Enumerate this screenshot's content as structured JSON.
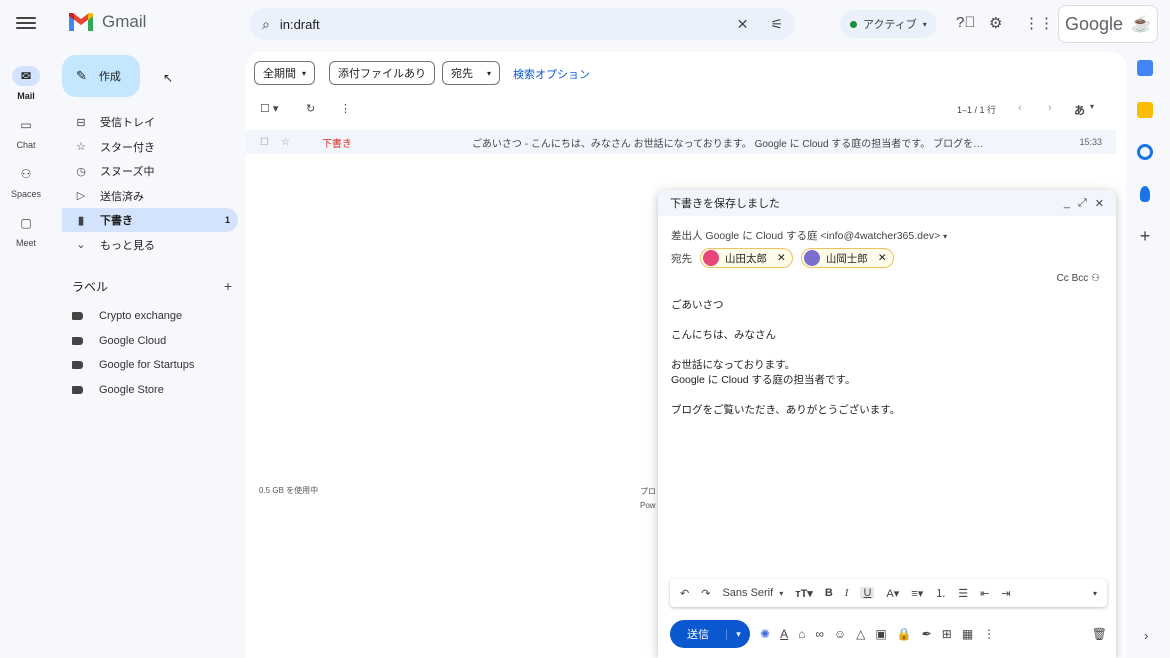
{
  "rail": {
    "items": [
      {
        "label": "Mail"
      },
      {
        "label": "Chat"
      },
      {
        "label": "Spaces"
      },
      {
        "label": "Meet"
      }
    ]
  },
  "app": {
    "name": "Gmail"
  },
  "search": {
    "query": "in:draft"
  },
  "status": {
    "label": "アクティブ"
  },
  "brand": {
    "google_text": "Google"
  },
  "compose": {
    "label": "作成"
  },
  "nav": {
    "items": [
      {
        "label": "受信トレイ",
        "count": ""
      },
      {
        "label": "スター付き",
        "count": ""
      },
      {
        "label": "スヌーズ中",
        "count": ""
      },
      {
        "label": "送信済み",
        "count": ""
      },
      {
        "label": "下書き",
        "count": "1"
      },
      {
        "label": "もっと見る",
        "count": ""
      }
    ]
  },
  "labels": {
    "heading": "ラベル",
    "items": [
      "Crypto exchange",
      "Google Cloud",
      "Google for Startups",
      "Google Store"
    ]
  },
  "filters": {
    "period": "全期間",
    "attachment": "添付ファイルあり",
    "to": "宛先",
    "search_options": "検索オプション"
  },
  "list": {
    "pagination": "1–1 / 1 行",
    "input_tool": "あ",
    "rows": [
      {
        "label": "下書き",
        "snippet": "ごあいさつ - こんにちは、みなさん お世話になっております。 Google に Cloud する庭の担当者です。 ブログを…",
        "time": "15:33"
      }
    ]
  },
  "footer": {
    "storage": "0.5 GB を使用中",
    "line1": "プロ",
    "line2": "Pow"
  },
  "draft": {
    "title": "下書きを保存しました",
    "from": "差出人 Google に Cloud する庭 <info@4watcher365.dev>",
    "to_label": "宛先",
    "recipients": [
      "山田太郎",
      "山岡士郎"
    ],
    "cc_bcc": "Cc Bcc",
    "body_lines": [
      "ごあいさつ",
      "",
      "こんにちは、みなさん",
      "",
      "お世話になっております。",
      "Google に Cloud する庭の担当者です。",
      "",
      "ブログをご覧いただき、ありがとうございます。"
    ],
    "font": "Sans Serif",
    "send_label": "送信"
  },
  "colors": {
    "accent": "#0b57d0",
    "compose_bg": "#c2e7ff",
    "active_nav": "#d3e3fd",
    "draft_label": "#d93025",
    "status_green": "#1e8e3e"
  }
}
